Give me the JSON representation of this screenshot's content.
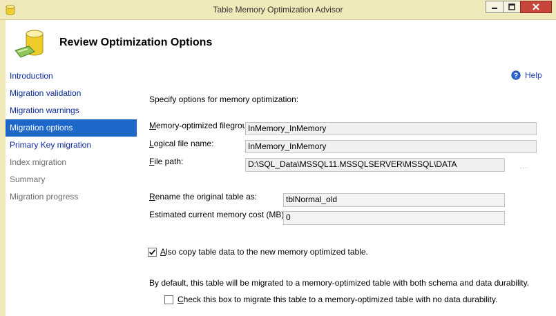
{
  "window": {
    "title": "Table Memory Optimization Advisor",
    "buttons": {
      "minimize": "minimize",
      "maximize": "maximize",
      "close": "close"
    }
  },
  "page": {
    "title": "Review Optimization Options"
  },
  "nav": {
    "items": [
      {
        "label": "Introduction",
        "state": "link"
      },
      {
        "label": "Migration validation",
        "state": "link"
      },
      {
        "label": "Migration warnings",
        "state": "link"
      },
      {
        "label": "Migration options",
        "state": "active"
      },
      {
        "label": "Primary Key migration",
        "state": "link"
      },
      {
        "label": "Index migration",
        "state": "disabled"
      },
      {
        "label": "Summary",
        "state": "disabled"
      },
      {
        "label": "Migration progress",
        "state": "disabled"
      }
    ]
  },
  "help": {
    "label": "Help"
  },
  "form": {
    "intro": "Specify options for memory optimization:",
    "filegroup": {
      "label_pre": "M",
      "label_rest": "emory-optimized filegroup:",
      "value": "InMemory_InMemory"
    },
    "logical_name": {
      "label_pre": "L",
      "label_rest": "ogical file name:",
      "value": "InMemory_InMemory"
    },
    "file_path": {
      "label_pre": "F",
      "label_rest": "ile path:",
      "value": "D:\\SQL_Data\\MSSQL11.MSSQLSERVER\\MSSQL\\DATA",
      "browse": "..."
    },
    "rename": {
      "label_pre": "R",
      "label_rest": "ename the original table as:",
      "value": "tblNormal_old"
    },
    "memory_cost": {
      "label": "Estimated current memory cost (MB):",
      "value": "0"
    },
    "copy_data": {
      "label_pre": "A",
      "label_rest": "lso copy table data to the new memory optimized table.",
      "checked": true
    },
    "durability_note": "By default, this table will be migrated to a memory-optimized table with both schema and data durability.",
    "no_durability": {
      "label_pre": "C",
      "label_rest": "heck this box to migrate this table to a memory-optimized table with no data durability.",
      "checked": false
    }
  },
  "colors": {
    "accent": "#1c67c8",
    "link": "#0b2a9d",
    "titlebar": "#f0e9ba",
    "close": "#c7463b"
  }
}
